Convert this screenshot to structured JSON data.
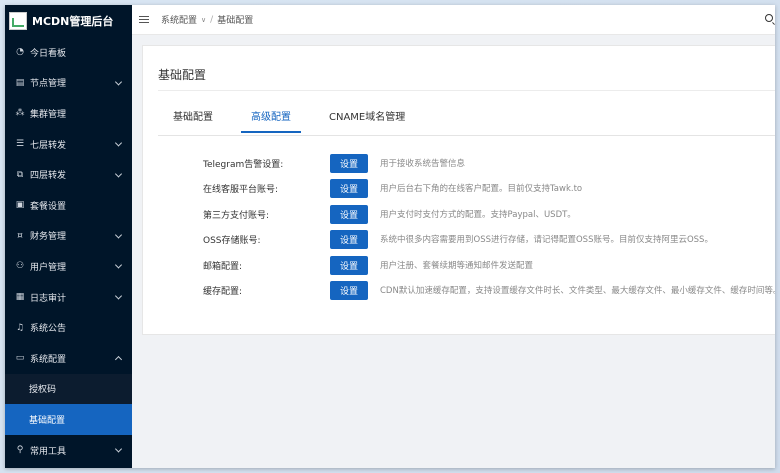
{
  "app": {
    "title": "MCDN管理后台"
  },
  "sidebar": {
    "items": [
      {
        "label": "今日看板",
        "icon": "dashboard-icon"
      },
      {
        "label": "节点管理",
        "icon": "server-icon",
        "expandable": true
      },
      {
        "label": "集群管理",
        "icon": "cluster-icon"
      },
      {
        "label": "七层转发",
        "icon": "list-icon",
        "expandable": true
      },
      {
        "label": "四层转发",
        "icon": "forward-icon",
        "expandable": true
      },
      {
        "label": "套餐设置",
        "icon": "package-icon"
      },
      {
        "label": "财务管理",
        "icon": "finance-icon",
        "expandable": true
      },
      {
        "label": "用户管理",
        "icon": "users-icon",
        "expandable": true
      },
      {
        "label": "日志审计",
        "icon": "log-icon",
        "expandable": true
      },
      {
        "label": "系统公告",
        "icon": "bell-icon"
      },
      {
        "label": "系统配置",
        "icon": "monitor-icon",
        "expanded": true
      }
    ],
    "sub_items": [
      {
        "label": "授权码",
        "active": false
      },
      {
        "label": "基础配置",
        "active": true
      }
    ],
    "last_item": {
      "label": "常用工具",
      "icon": "tool-icon",
      "expandable": true
    }
  },
  "header": {
    "breadcrumb": [
      "系统配置",
      "/",
      "基础配置"
    ]
  },
  "main": {
    "title": "基础配置",
    "tabs": [
      {
        "label": "基础配置",
        "active": false
      },
      {
        "label": "高级配置",
        "active": true
      },
      {
        "label": "CNAME域名管理",
        "active": false
      }
    ],
    "button_label": "设置",
    "rows": [
      {
        "label": "Telegram告警设置:",
        "desc": "用于接收系统告警信息"
      },
      {
        "label": "在线客服平台账号:",
        "desc": "用户后台右下角的在线客户配置。目前仅支持Tawk.to"
      },
      {
        "label": "第三方支付账号:",
        "desc": "用户支付时支付方式的配置。支持Paypal、USDT。"
      },
      {
        "label": "OSS存储账号:",
        "desc": "系统中很多内容需要用到OSS进行存储，请记得配置OSS账号。目前仅支持阿里云OSS。"
      },
      {
        "label": "邮箱配置:",
        "desc": "用户注册、套餐续期等通知邮件发送配置"
      },
      {
        "label": "缓存配置:",
        "desc": "CDN默认加速缓存配置，支持设置缓存文件时长、文件类型、最大缓存文件、最小缓存文件、缓存时间等。"
      }
    ]
  },
  "colors": {
    "sidebar_bg": "#001529",
    "accent": "#1565c0"
  }
}
